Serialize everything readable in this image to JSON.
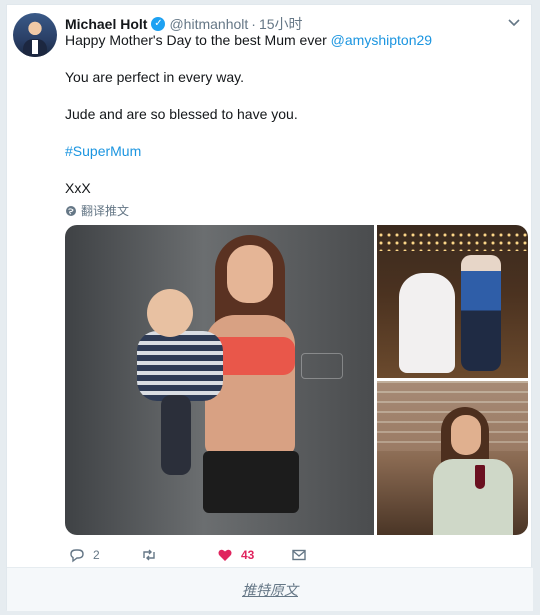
{
  "tweet": {
    "author_name": "Michael Holt",
    "handle": "@hitmanholt",
    "separator": "·",
    "time": "15小时",
    "line1_prefix": "Happy Mother's Day to the best Mum ever ",
    "mention": "@amyshipton29",
    "line2": "You are perfect in every way.",
    "line3": "Jude and are so blessed to have you.",
    "hashtag": "#SuperMum",
    "signoff": "XxX",
    "translate_label": "翻译推文"
  },
  "actions": {
    "reply_count": "2",
    "like_count": "43"
  },
  "footer": {
    "view_original": "推特原文"
  },
  "colors": {
    "link": "#1b95e0",
    "like": "#e0245e",
    "verified": "#1da1f2",
    "muted": "#657786"
  },
  "icons": [
    "verified-badge-icon",
    "chevron-down-icon",
    "globe-icon",
    "reply-icon",
    "retweet-icon",
    "heart-icon",
    "message-icon"
  ]
}
